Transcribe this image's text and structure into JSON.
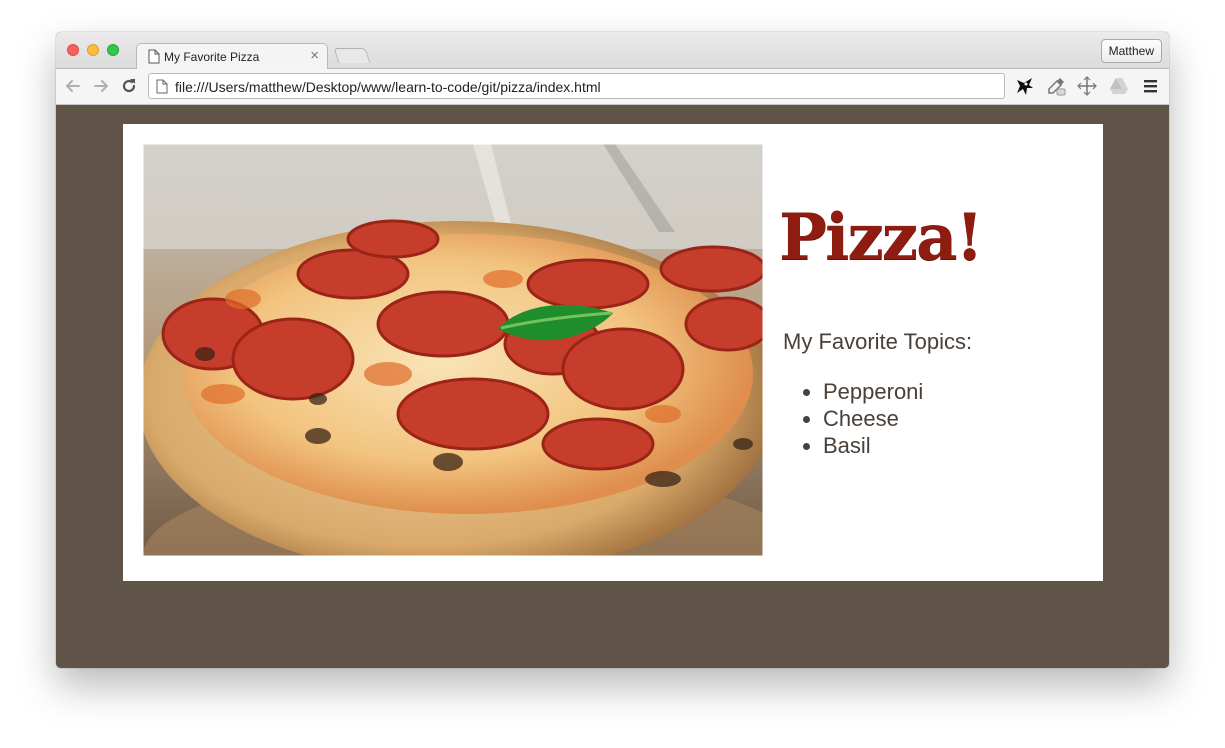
{
  "browser": {
    "tab_title": "My Favorite Pizza",
    "tab_close_glyph": "×",
    "profile_name": "Matthew",
    "url": "file:///Users/matthew/Desktop/www/learn-to-code/git/pizza/index.html",
    "icons": {
      "back": "back-arrow-icon",
      "forward": "forward-arrow-icon",
      "reload": "reload-icon",
      "extension_1": "ninja-extension-icon",
      "extension_2": "eyedropper-icon",
      "extension_3": "crosshair-icon",
      "extension_4": "drive-icon",
      "menu": "hamburger-menu-icon"
    },
    "colors": {
      "page_background": "#5f5447",
      "heading": "#8f1c10",
      "text": "#4a4038"
    }
  },
  "page": {
    "heading": "Pizza!",
    "topics_heading": "My Favorite Topics:",
    "topics": [
      "Pepperoni",
      "Cheese",
      "Basil"
    ],
    "image_subject": "pepperoni pizza with basil"
  }
}
